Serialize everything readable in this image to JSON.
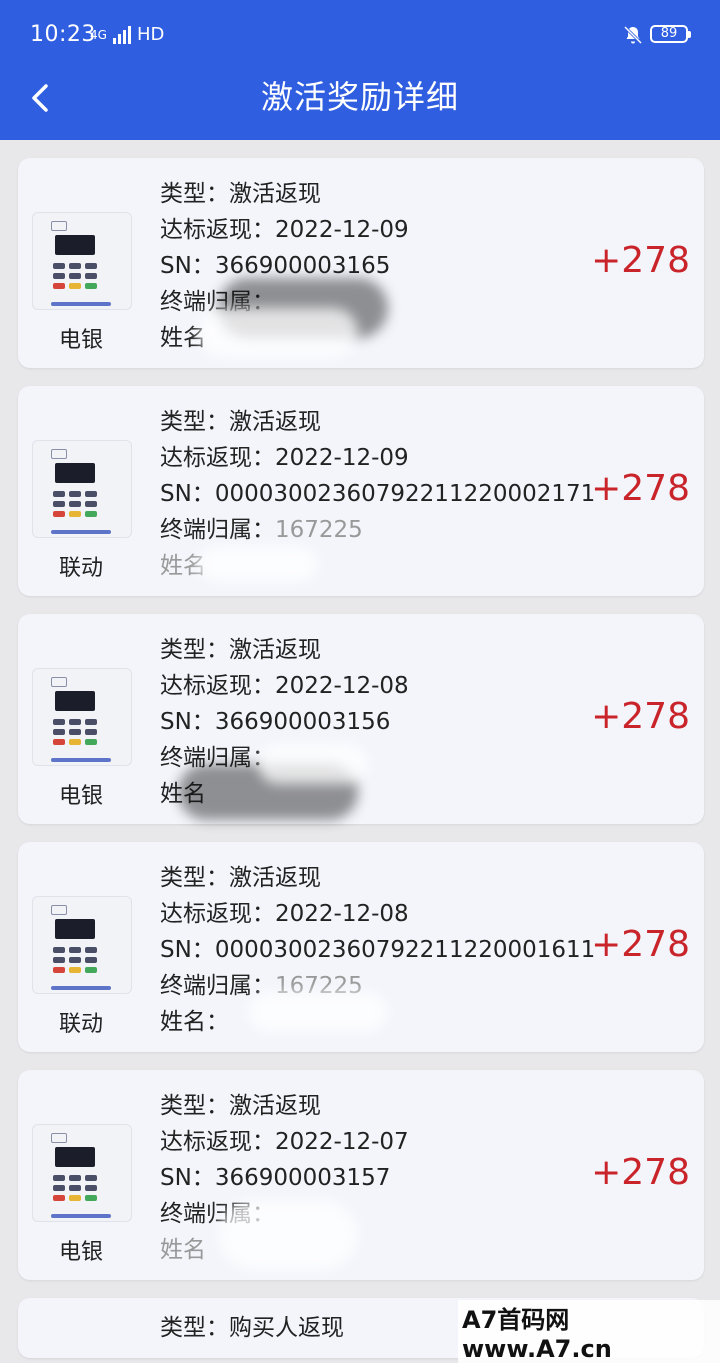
{
  "status": {
    "time": "10:23",
    "net": "4G",
    "hd": "HD",
    "battery": "89"
  },
  "header": {
    "title": "激活奖励详细"
  },
  "cards": [
    {
      "device": "电银",
      "type_label": "类型：",
      "type": "激活返现",
      "date_label": "达标返现：",
      "date": "2022-12-09",
      "sn_label": "SN：",
      "sn": "366900003165",
      "owner_label": "终端归属：",
      "owner": "",
      "name_label": "姓名",
      "name": "",
      "amount": "+278"
    },
    {
      "device": "联动",
      "type_label": "类型：",
      "type": "激活返现",
      "date_label": "达标返现：",
      "date": "2022-12-09",
      "sn_label": "SN：",
      "sn": "00003002360792211220002171",
      "owner_label": "终端归属：",
      "owner": "167225",
      "name_label": "姓名",
      "name": "",
      "amount": "+278"
    },
    {
      "device": "电银",
      "type_label": "类型：",
      "type": "激活返现",
      "date_label": "达标返现：",
      "date": "2022-12-08",
      "sn_label": "SN：",
      "sn": "366900003156",
      "owner_label": "终端归属：",
      "owner": "",
      "name_label": "姓名",
      "name": "",
      "amount": "+278"
    },
    {
      "device": "联动",
      "type_label": "类型：",
      "type": "激活返现",
      "date_label": "达标返现：",
      "date": "2022-12-08",
      "sn_label": "SN：",
      "sn": "00003002360792211220001611",
      "owner_label": "终端归属：",
      "owner": "167225",
      "name_label": "姓名：",
      "name": "",
      "amount": "+278"
    },
    {
      "device": "电银",
      "type_label": "类型：",
      "type": "激活返现",
      "date_label": "达标返现：",
      "date": "2022-12-07",
      "sn_label": "SN：",
      "sn": "366900003157",
      "owner_label": "终端归属：",
      "owner": "",
      "name_label": "姓名",
      "name": "",
      "amount": "+278"
    }
  ],
  "partial_card": {
    "type_label": "类型：",
    "type": "购买人返现"
  },
  "watermark": "A7首码网www.A7.cn"
}
